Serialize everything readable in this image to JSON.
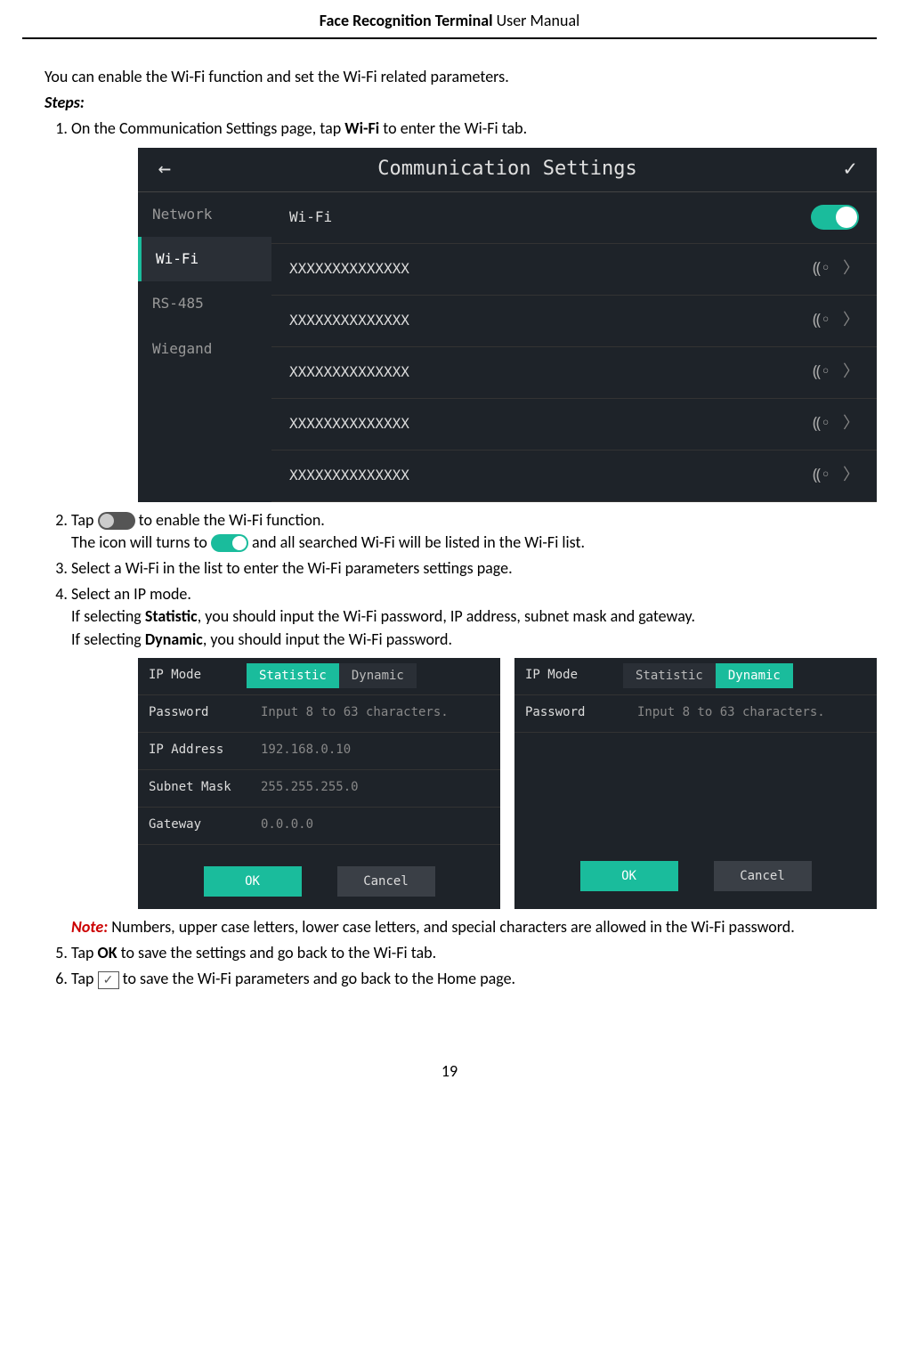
{
  "header": {
    "title_bold": "Face Recognition Terminal",
    "title_rest": "  User Manual"
  },
  "intro": "You can enable the Wi-Fi function and set the Wi-Fi related parameters.",
  "steps_label": "Steps:",
  "step1": {
    "pre": "On the Communication Settings page, tap ",
    "bold": "Wi-Fi",
    "post": " to enter the Wi-Fi tab."
  },
  "screenshot1": {
    "title": "Communication Settings",
    "sidebar": [
      "Network",
      "Wi-Fi",
      "RS-485",
      "Wiegand"
    ],
    "sidebar_active_index": 1,
    "wifi_label": "Wi-Fi",
    "wifi_on": true,
    "networks": [
      "XXXXXXXXXXXXXX",
      "XXXXXXXXXXXXXX",
      "XXXXXXXXXXXXXX",
      "XXXXXXXXXXXXXX",
      "XXXXXXXXXXXXXX"
    ]
  },
  "step2": {
    "pre": "Tap ",
    "mid": " to enable the Wi-Fi function.",
    "line2_pre": "The icon will turns to ",
    "line2_post": " and all searched Wi-Fi will be listed in the Wi-Fi list."
  },
  "step3": "Select a Wi-Fi in the list to enter the Wi-Fi parameters settings page.",
  "step4": {
    "line1": "Select an IP mode.",
    "line2_pre": "If selecting ",
    "line2_bold": "Statistic",
    "line2_post": ", you should input the Wi-Fi password, IP address, subnet mask and gateway.",
    "line3_pre": "If selecting ",
    "line3_bold": "Dynamic",
    "line3_post": ", you should input the Wi-Fi password."
  },
  "panels": {
    "ip_mode_label": "IP Mode",
    "seg_statistic": "Statistic",
    "seg_dynamic": "Dynamic",
    "password_label": "Password",
    "password_placeholder": "Input 8 to 63 characters.",
    "ip_label": "IP Address",
    "ip_val": "192.168.0.10",
    "subnet_label": "Subnet Mask",
    "subnet_val": "255.255.255.0",
    "gateway_label": "Gateway",
    "gateway_val": "0.0.0.0",
    "ok": "OK",
    "cancel": "Cancel"
  },
  "note": {
    "label": "Note:",
    "text": " Numbers, upper case letters, lower case letters, and special characters are allowed in the Wi-Fi password."
  },
  "step5": {
    "pre": "Tap ",
    "bold": "OK",
    "post": " to save the settings and go back to the Wi-Fi tab."
  },
  "step6": {
    "pre": "Tap ",
    "post": " to save the Wi-Fi parameters and go back to the Home page."
  },
  "page_number": "19"
}
